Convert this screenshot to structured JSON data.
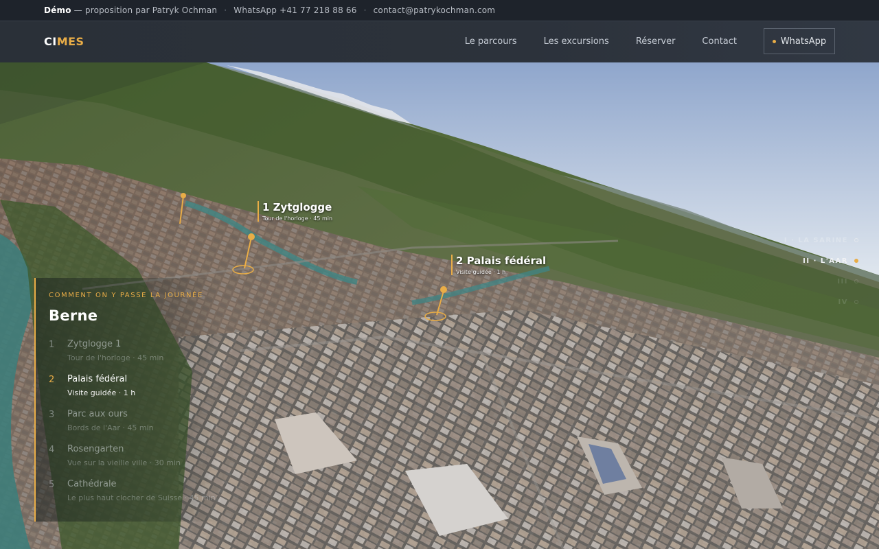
{
  "topbar": {
    "demo": "Démo",
    "proposition": "— proposition par Patryk Ochman",
    "separator": "·",
    "whatsapp": "WhatsApp +41 77 218 88 66",
    "email": "contact@patrykochman.com"
  },
  "nav": {
    "logo_part1": "CI",
    "logo_part2": "MES",
    "links": [
      "Le parcours",
      "Les excursions",
      "Réserver",
      "Contact"
    ],
    "whatsapp_button": "WhatsApp"
  },
  "map_markers": [
    {
      "title": "1 Zytglogge",
      "subtitle": "Tour de l'horloge · 45 min"
    },
    {
      "title": "2 Palais fédéral",
      "subtitle": "Visite guidée · 1 h"
    }
  ],
  "sections": [
    {
      "label": "I · LA SARINE",
      "state": "inactive"
    },
    {
      "label": "II · L'AAR",
      "state": "active"
    },
    {
      "label": "III",
      "state": "dim"
    },
    {
      "label": "IV",
      "state": "dim"
    }
  ],
  "panel": {
    "kicker": "COMMENT ON Y PASSE LA JOURNÉE",
    "city": "Berne",
    "stops": [
      {
        "num": "1",
        "name": "Zytglogge 1",
        "desc": "Tour de l'horloge · 45 min",
        "active": false
      },
      {
        "num": "2",
        "name": "Palais fédéral",
        "desc": "Visite guidée · 1 h",
        "active": true
      },
      {
        "num": "3",
        "name": "Parc aux ours",
        "desc": "Bords de l'Aar · 45 min",
        "active": false
      },
      {
        "num": "4",
        "name": "Rosengarten",
        "desc": "Vue sur la vieille ville · 30 min",
        "active": false
      },
      {
        "num": "5",
        "name": "Cathédrale",
        "desc": "Le plus haut clocher de Suisse · 45 min",
        "active": false
      }
    ]
  },
  "colors": {
    "accent": "#e9ad47",
    "nav": "#2c323b",
    "topbar": "#1e232b"
  }
}
